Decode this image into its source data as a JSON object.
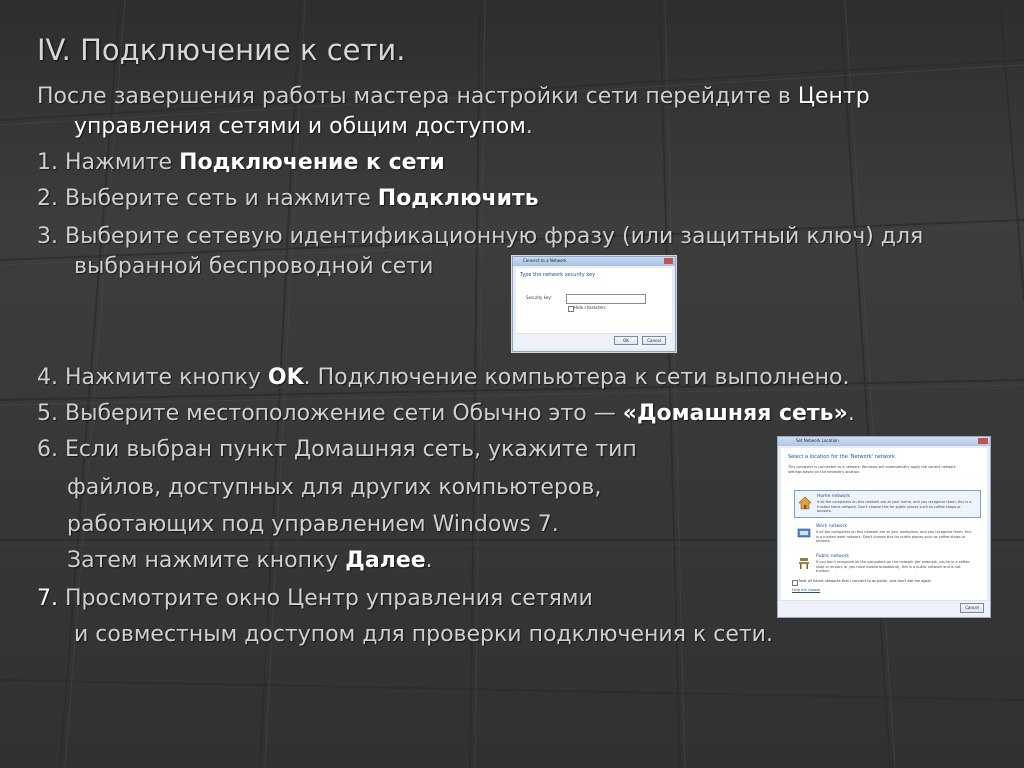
{
  "slide": {
    "title": "IV. Подключение к сети.",
    "intro_part1": "После завершения работы мастера настройки сети перейдите в ",
    "intro_bold1": "Центр",
    "intro_bold2": "управления сетями и общим доступом",
    "intro_end": ".",
    "step1_text": "1. Нажмите ",
    "step1_bold": "Подключение к сети",
    "step2_text": "2. Выберите сеть и нажмите ",
    "step2_bold": "Подключить",
    "step3_line1": "3. Выберите сетевую идентификационную фразу (или защитный ключ) для",
    "step3_line2": "выбранной беспроводной сети",
    "step4_text": "4. Нажмите кнопку ",
    "step4_bold": "OK",
    "step4_rest": ". Подключение компьютера к сети выполнено.",
    "step5_text": "5. Выберите местоположение сети Обычно это — ",
    "step5_bold": "«Домашняя сеть»",
    "step5_end": ".",
    "step6_line1": "6. Если выбран пункт Домашняя сеть, укажите тип",
    "step6_line2": "файлов, доступных для других компьютеров,",
    "step6_line3": "работающих под управлением Windows 7.",
    "step6_line4_text": "Затем нажмите кнопку ",
    "step6_line4_bold": "Далее",
    "step6_line4_end": ".",
    "step7_num": "7.",
    "step7_line1": " Просмотрите окно Центр управления сетями",
    "step7_line2": "и совместным доступом для проверки подключения к сети."
  },
  "dialog1": {
    "title": "Connect to a Network",
    "heading": "Type the network security key",
    "key_label": "Security key:",
    "hide_label": "Hide characters",
    "ok_label": "OK",
    "cancel_label": "Cancel"
  },
  "dialog2": {
    "title": "Set Network Location",
    "heading": "Select a location for the 'Network' network",
    "description": "This computer is connected to a network. Windows will automatically apply the correct network settings based on the network's location.",
    "options": [
      {
        "title": "Home network",
        "desc": "If all the computers on this network are at your home, and you recognize them, this is a trusted home network. Don't choose this for public places such as coffee shops or airports."
      },
      {
        "title": "Work network",
        "desc": "If all the computers on this network are at your workplace, and you recognize them, this is a trusted work network. Don't choose this for public places such as coffee shops or airports."
      },
      {
        "title": "Public network",
        "desc": "If you don't recognize all the computers on the network (for example, you're in a coffee shop or airport, or you have mobile broadband), this is a public network and is not trusted."
      }
    ],
    "treat_label": "Treat all future networks that I connect to as public, and don't ask me again.",
    "help_label": "Help me choose",
    "cancel_label": "Cancel"
  }
}
